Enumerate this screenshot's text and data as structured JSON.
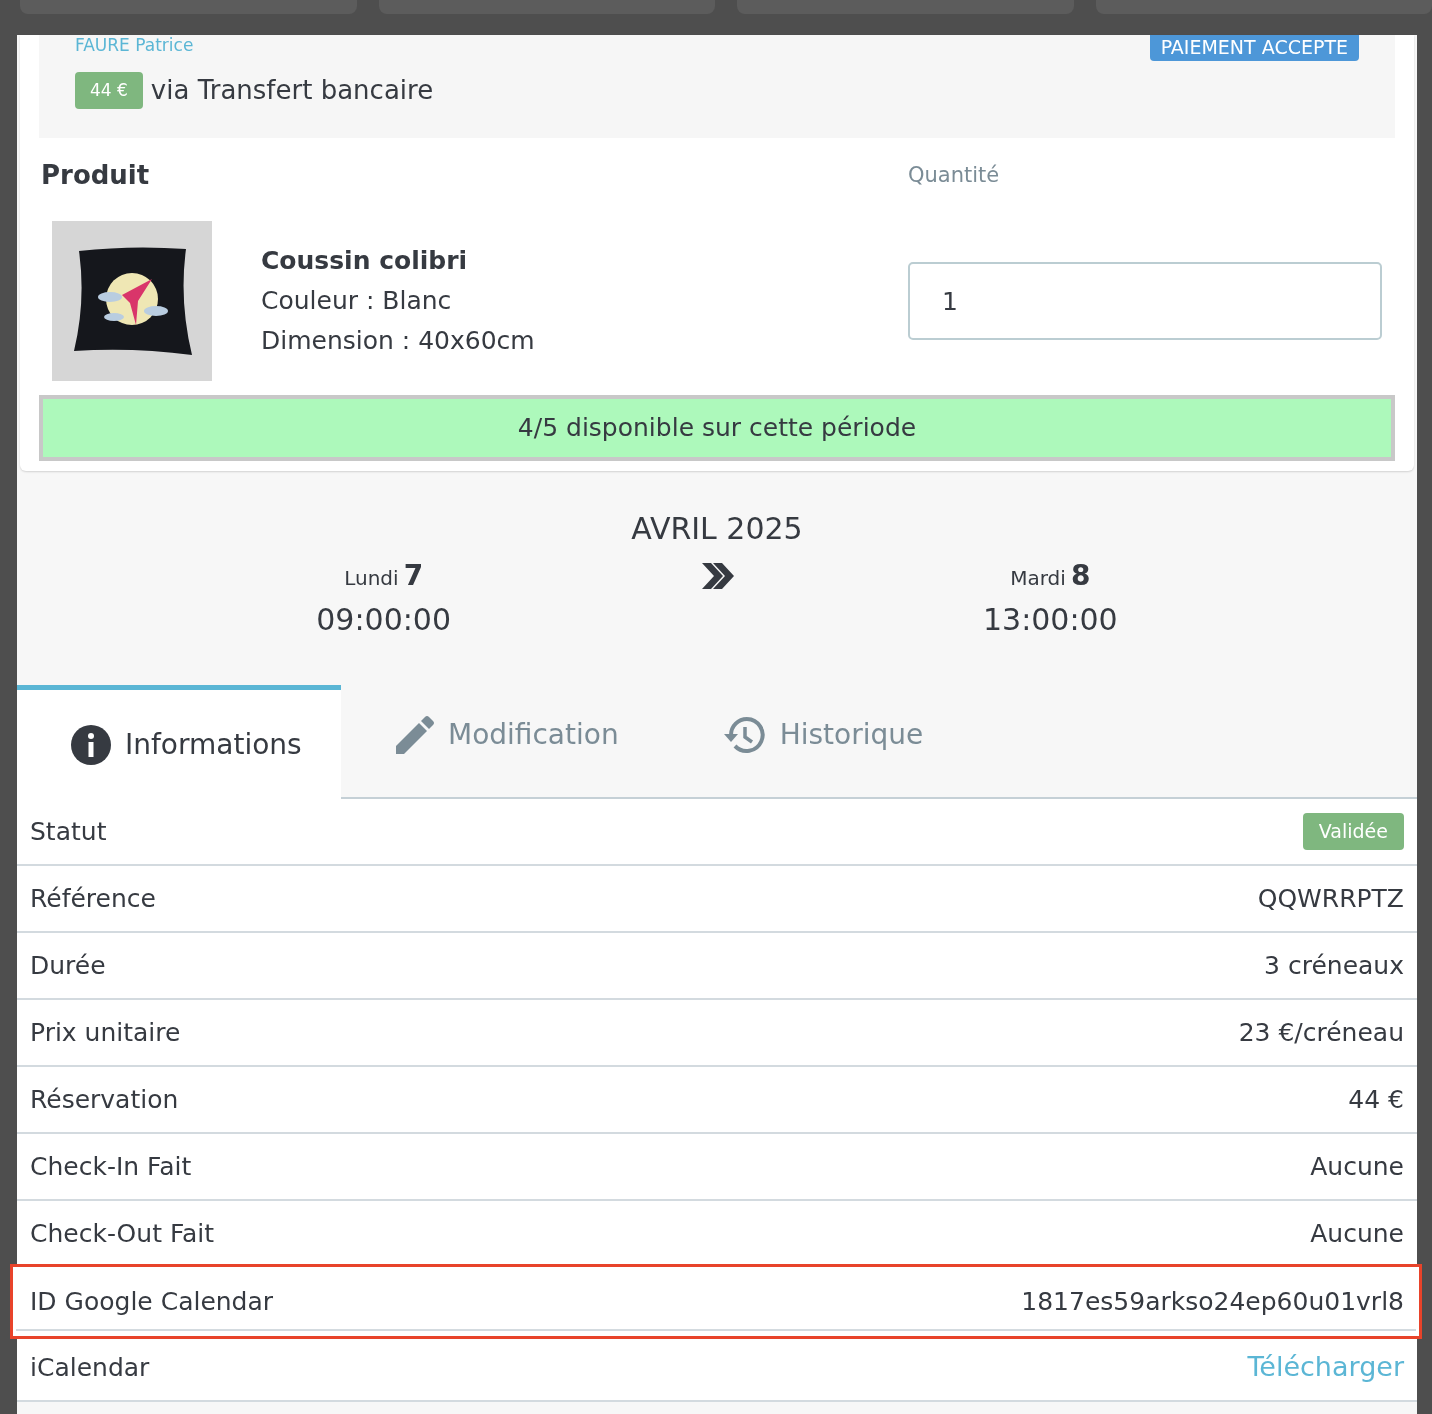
{
  "customer": {
    "name": "FAURE Patrice"
  },
  "payment_status": "PAIEMENT ACCEPTE",
  "payment": {
    "amount": "44 €",
    "method": "via Transfert bancaire"
  },
  "product": {
    "heading": "Produit",
    "quantity_label": "Quantité",
    "image": {
      "kind": "picture"
    },
    "name": "Coussin colibri",
    "attributes": [
      "Couleur : Blanc",
      "Dimension : 40x60cm"
    ],
    "quantity": "1"
  },
  "availability": "4/5 disponible sur cette période",
  "period": {
    "month": "AVRIL 2025",
    "start": {
      "day_name": "Lundi",
      "day": "7",
      "time": "09:00:00"
    },
    "end": {
      "day_name": "Mardi",
      "day": "8",
      "time": "13:00:00"
    }
  },
  "tabs": [
    {
      "label": "Informations",
      "selected": true
    },
    {
      "label": "Modification",
      "selected": false
    },
    {
      "label": "Historique",
      "selected": false
    }
  ],
  "details": [
    {
      "label": "Statut",
      "value": "Validée",
      "kind": "badge",
      "highlighted": false
    },
    {
      "label": "Référence",
      "value": "QQWRRPTZ",
      "kind": "text",
      "highlighted": false
    },
    {
      "label": "Durée",
      "value": "3 créneaux",
      "kind": "text",
      "highlighted": false
    },
    {
      "label": "Prix unitaire",
      "value": "23 €/créneau",
      "kind": "text",
      "highlighted": false
    },
    {
      "label": "Réservation",
      "value": "44 €",
      "kind": "text",
      "highlighted": false
    },
    {
      "label": "Check-In Fait",
      "value": "Aucune",
      "kind": "text",
      "highlighted": false
    },
    {
      "label": "Check-Out Fait",
      "value": "Aucune",
      "kind": "text",
      "highlighted": false
    },
    {
      "label": "ID Google Calendar",
      "value": "1817es59arkso24ep60u01vrl8",
      "kind": "text",
      "highlighted": true
    },
    {
      "label": "iCalendar",
      "value": "Télécharger",
      "kind": "link",
      "highlighted": false
    }
  ]
}
